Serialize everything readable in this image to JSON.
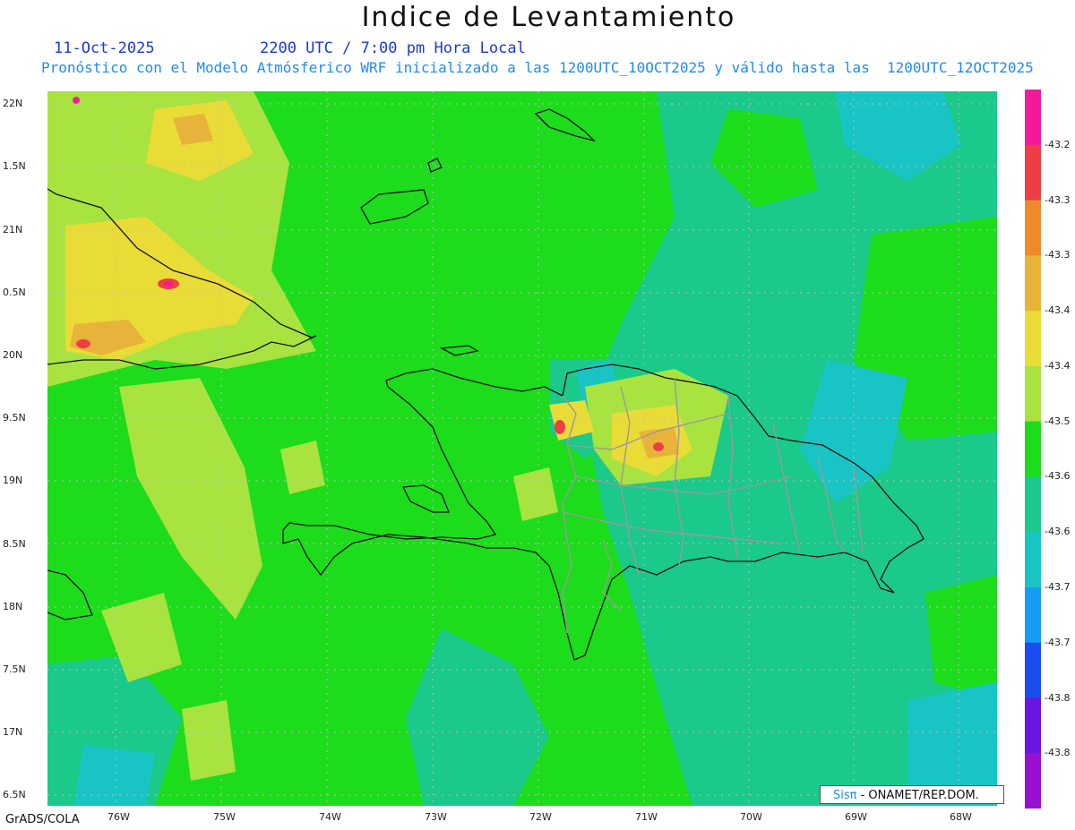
{
  "header": {
    "title": "Indice de Levantamiento",
    "date": "11-Oct-2025",
    "time": "2200 UTC / 7:00 pm Hora Local",
    "subtitle": "Pronóstico con el Modelo Atmósferico WRF inicializado a las 1200UTC_10OCT2025 y válido hasta las  1200UTC_12OCT2025"
  },
  "lat_labels": [
    "22N",
    "1.5N",
    "21N",
    "0.5N",
    "20N",
    "9.5N",
    "19N",
    "8.5N",
    "18N",
    "7.5N",
    "17N",
    "6.5N"
  ],
  "lon_labels": [
    "76W",
    "75W",
    "74W",
    "73W",
    "72W",
    "71W",
    "70W",
    "69W",
    "68W"
  ],
  "colorbar": {
    "labels": [
      "-43.2",
      "-43.3",
      "-43.3",
      "-43.4",
      "-43.4",
      "-43.5",
      "-43.6",
      "-43.6",
      "-43.7",
      "-43.7",
      "-43.8",
      "-43.8"
    ],
    "colors": [
      "#f21a9a",
      "#ee3e44",
      "#ef8a2c",
      "#e8b33a",
      "#eadc36",
      "#a8e340",
      "#1ddc1c",
      "#1bc98a",
      "#19c5c4",
      "#149df2",
      "#1a4cf0",
      "#6a16e2",
      "#9a10d2"
    ]
  },
  "footer": {
    "credit": "GrADS/COLA",
    "logo_mark": "Sisπ",
    "logo_text": " - ONAMET/REP.DOM."
  },
  "map_colors": {
    "base": "#1ddc1c",
    "light_green": "#a8e340",
    "yellow": "#eadc36",
    "orange": "#e8b33a",
    "red": "#ee3e44",
    "magenta": "#f21a9a",
    "teal": "#1bc98a",
    "cyan": "#19c5c4"
  }
}
